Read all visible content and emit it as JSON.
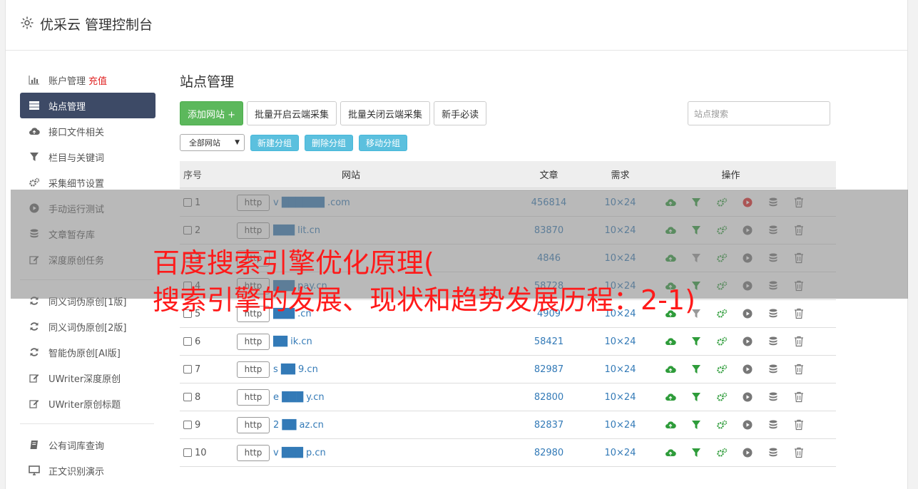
{
  "app": {
    "title": "优采云 管理控制台"
  },
  "sidebar": {
    "items": [
      {
        "label": "账户管理",
        "badge": "充值",
        "icon": "bar-chart-icon"
      },
      {
        "label": "站点管理",
        "icon": "server-icon",
        "active": true
      },
      {
        "label": "接口文件相关",
        "icon": "cloud-upload-icon"
      },
      {
        "label": "栏目与关键词",
        "icon": "filter-icon"
      },
      {
        "label": "采集细节设置",
        "icon": "gears-icon"
      },
      {
        "label": "手动运行测试",
        "icon": "play-circle-icon"
      },
      {
        "label": "文章暂存库",
        "icon": "database-icon"
      },
      {
        "label": "深度原创任务",
        "icon": "edit-icon"
      }
    ],
    "items2": [
      {
        "label": "同义词伪原创[1版]",
        "icon": "refresh-icon"
      },
      {
        "label": "同义词伪原创[2版]",
        "icon": "refresh-icon"
      },
      {
        "label": "智能伪原创[AI版]",
        "icon": "refresh-icon"
      },
      {
        "label": "UWriter深度原创",
        "icon": "edit-icon"
      },
      {
        "label": "UWriter原创标题",
        "icon": "edit-icon"
      }
    ],
    "items3": [
      {
        "label": "公有词库查询",
        "icon": "book-icon"
      },
      {
        "label": "正文识别演示",
        "icon": "monitor-icon"
      }
    ]
  },
  "main": {
    "title": "站点管理",
    "buttons": {
      "add": "添加网站 +",
      "batch_open": "批量开启云端采集",
      "batch_close": "批量关闭云端采集",
      "guide": "新手必读"
    },
    "search_placeholder": "站点搜索",
    "filter_select": "全部网站",
    "group_buttons": {
      "new": "新建分组",
      "delete": "删除分组",
      "move": "移动分组"
    },
    "table": {
      "headers": {
        "no": "序号",
        "site": "网站",
        "articles": "文章",
        "need": "需求",
        "ops": "操作"
      },
      "protocol": "http",
      "rows": [
        {
          "no": "1",
          "domain": "v ██████ .com",
          "articles": "456814",
          "need": "10×24",
          "run_active": true
        },
        {
          "no": "2",
          "domain": "███ lit.cn",
          "articles": "83870",
          "need": "10×24"
        },
        {
          "no": "3",
          "domain": "",
          "articles": "4846",
          "need": "10×24",
          "filter_gray": true
        },
        {
          "no": "4",
          "domain": "███ pay.cn",
          "articles": "58728",
          "need": "10×24"
        },
        {
          "no": "5",
          "domain": "███ .cn",
          "articles": "4909",
          "need": "10×24",
          "filter_gray": true
        },
        {
          "no": "6",
          "domain": "██ ik.cn",
          "articles": "58421",
          "need": "10×24"
        },
        {
          "no": "7",
          "domain": "s ██ 9.cn",
          "articles": "82987",
          "need": "10×24"
        },
        {
          "no": "8",
          "domain": "e ███ y.cn",
          "articles": "82800",
          "need": "10×24"
        },
        {
          "no": "9",
          "domain": "2 ██ az.cn",
          "articles": "82837",
          "need": "10×24"
        },
        {
          "no": "10",
          "domain": "v ███ p.cn",
          "articles": "82980",
          "need": "10×24"
        }
      ]
    }
  },
  "overlay": {
    "line1": "百度搜索引擎优化原理(",
    "line2": "搜索引擎的发展、现状和趋势发展历程：2-1)"
  },
  "colors": {
    "accent": "#3d4a66",
    "green": "#5cb85c",
    "info": "#5bc0de",
    "link": "#337ab7",
    "overlay_text": "#ff1a1a"
  }
}
